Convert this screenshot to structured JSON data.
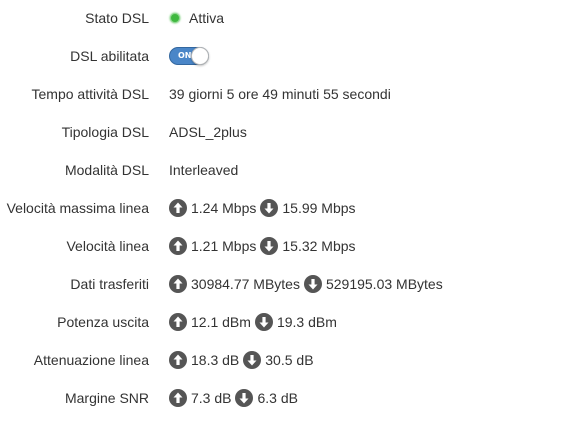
{
  "colors": {
    "status_active": "#3fb83f",
    "toggle_on": "#4a86c8",
    "arrow_icon_bg": "#555555"
  },
  "icons": {
    "upload": "arrow-up-circle-icon",
    "download": "arrow-down-circle-icon"
  },
  "dsl": {
    "stato": {
      "label": "Stato DSL",
      "value": "Attiva"
    },
    "abilitata": {
      "label": "DSL abilitata",
      "toggle_text": "ON"
    },
    "tempo_attivita": {
      "label": "Tempo attività DSL",
      "value": "39 giorni 5 ore 49 minuti 55 secondi"
    },
    "tipologia": {
      "label": "Tipologia DSL",
      "value": "ADSL_2plus"
    },
    "modalita": {
      "label": "Modalità DSL",
      "value": "Interleaved"
    },
    "velocita_massima": {
      "label": "Velocità massima linea",
      "up": "1.24 Mbps",
      "down": "15.99 Mbps"
    },
    "velocita_linea": {
      "label": "Velocità linea",
      "up": "1.21 Mbps",
      "down": "15.32 Mbps"
    },
    "dati_trasferiti": {
      "label": "Dati trasferiti",
      "up": "30984.77 MBytes",
      "down": "529195.03 MBytes"
    },
    "potenza_uscita": {
      "label": "Potenza uscita",
      "up": "12.1 dBm",
      "down": "19.3 dBm"
    },
    "attenuazione": {
      "label": "Attenuazione linea",
      "up": "18.3 dB",
      "down": "30.5 dB"
    },
    "margine_snr": {
      "label": "Margine SNR",
      "up": "7.3 dB",
      "down": "6.3 dB"
    }
  }
}
